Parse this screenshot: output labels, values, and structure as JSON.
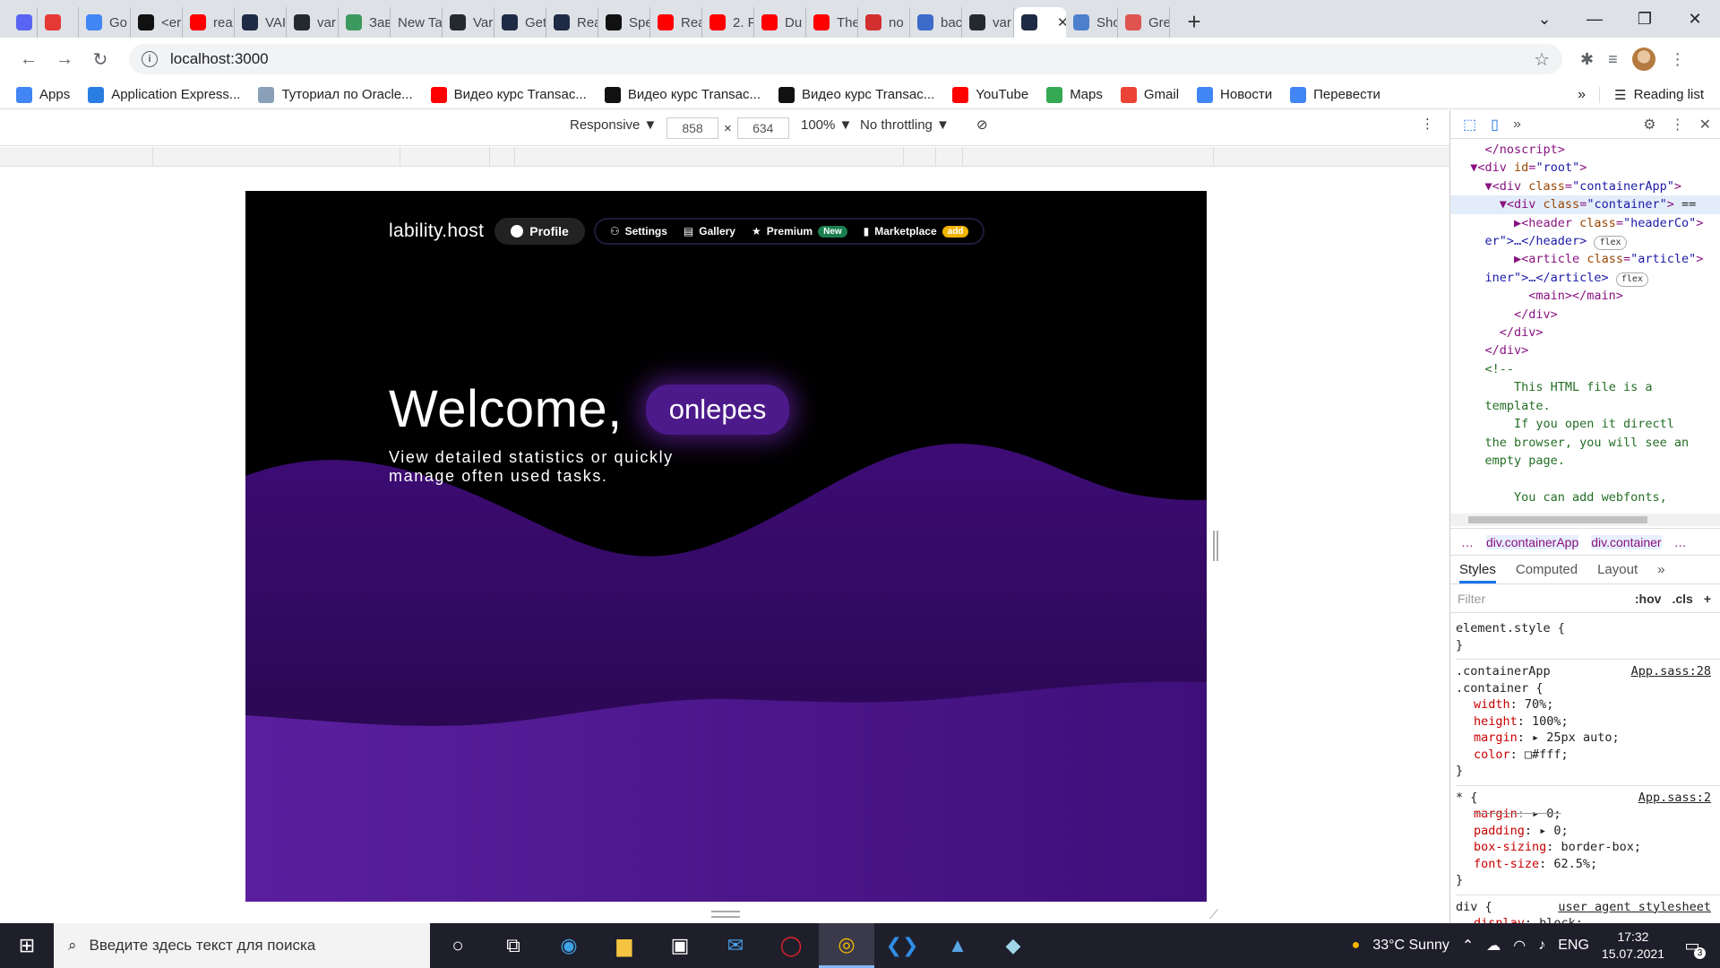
{
  "browser": {
    "tabs": [
      {
        "label": "",
        "color": "#5865f2"
      },
      {
        "label": "",
        "color": "#e53935"
      },
      {
        "label": "Go",
        "color": "#4285f4"
      },
      {
        "label": "<er",
        "color": "#111111"
      },
      {
        "label": "rea",
        "color": "#ff0000"
      },
      {
        "label": "VAI",
        "color": "#1f2a44"
      },
      {
        "label": "var",
        "color": "#24292e"
      },
      {
        "label": "Зав",
        "color": "#3c9a5f"
      },
      {
        "label": "New Tal",
        "color": ""
      },
      {
        "label": "Var",
        "color": "#24292e"
      },
      {
        "label": "Get",
        "color": "#1f2a44"
      },
      {
        "label": "Rea",
        "color": "#1f2a44"
      },
      {
        "label": "Spe",
        "color": "#111111"
      },
      {
        "label": "Rea",
        "color": "#ff0000"
      },
      {
        "label": "2. F",
        "color": "#ff0000"
      },
      {
        "label": "Du",
        "color": "#ff0000"
      },
      {
        "label": "The",
        "color": "#ff0000"
      },
      {
        "label": "no",
        "color": "#d32f2f"
      },
      {
        "label": "bac",
        "color": "#3c6bc9"
      },
      {
        "label": "var",
        "color": "#24292e"
      },
      {
        "label": "",
        "color": "#1f2a44",
        "active": true
      },
      {
        "label": "Sho",
        "color": "#4d7fcf"
      },
      {
        "label": "Gre",
        "color": "#e0544f"
      }
    ],
    "new_tab_glyph": "+",
    "url": "localhost:3000",
    "bookmarks": [
      {
        "label": "Apps",
        "icon": "apps-grid-icon",
        "color": "#4285f4"
      },
      {
        "label": "Application Express...",
        "icon": "apex-icon",
        "color": "#2a7de1"
      },
      {
        "label": "Туториал по Oracle...",
        "icon": "h-icon",
        "color": "#8aa0b8"
      },
      {
        "label": "Видео курс Transac...",
        "icon": "youtube-icon",
        "color": "#ff0000"
      },
      {
        "label": "Видео курс Transac...",
        "icon": "it-icon",
        "color": "#111111"
      },
      {
        "label": "Видео курс Transac...",
        "icon": "it-icon",
        "color": "#111111"
      },
      {
        "label": "YouTube",
        "icon": "youtube-icon",
        "color": "#ff0000"
      },
      {
        "label": "Maps",
        "icon": "maps-icon",
        "color": "#34a853"
      },
      {
        "label": "Gmail",
        "icon": "gmail-icon",
        "color": "#ea4335"
      },
      {
        "label": "Новости",
        "icon": "news-icon",
        "color": "#4285f4"
      },
      {
        "label": "Перевести",
        "icon": "translate-icon",
        "color": "#4285f4"
      }
    ],
    "bookmarks_more": "»",
    "reading_list": "Reading list"
  },
  "device_toolbar": {
    "mode": "Responsive ▼",
    "width": "858",
    "times": "×",
    "height": "634",
    "zoom": "100% ▼",
    "throttling": "No throttling ▼"
  },
  "app": {
    "logo": "lability.host",
    "profile_label": "Profile",
    "nav": [
      {
        "label": "Settings",
        "icon": "user-plus-icon"
      },
      {
        "label": "Gallery",
        "icon": "images-icon"
      },
      {
        "label": "Premium",
        "icon": "star-icon",
        "badge": "New",
        "badge_color": "#1a7f4e"
      },
      {
        "label": "Marketplace",
        "icon": "bag-icon",
        "badge": "add",
        "badge_color": "#f0b400"
      }
    ],
    "welcome": "Welcome,",
    "username": "onlepes",
    "subtitle": "View detailed statistics or quickly manage often used tasks.",
    "colors": {
      "wave_top": "#3a0a6e",
      "wave_mid": "#2a0650",
      "wave_bottom": "#5b1f9c"
    }
  },
  "devtools": {
    "elements": [
      {
        "indent": 2,
        "html": "</noscript>"
      },
      {
        "indent": 1,
        "arrow": "▼",
        "tag": "div",
        "attrs": [
          [
            "id",
            "root"
          ]
        ]
      },
      {
        "indent": 2,
        "arrow": "▼",
        "tag": "div",
        "attrs": [
          [
            "class",
            "containerApp"
          ]
        ]
      },
      {
        "indent": 3,
        "arrow": "▼",
        "tag": "div",
        "attrs": [
          [
            "class",
            "container"
          ]
        ],
        "highlight": true,
        "suffix": " =="
      },
      {
        "indent": 4,
        "arrow": "▶",
        "tag": "header",
        "attrs": [
          [
            "class",
            "headerCo"
          ]
        ],
        "wrap": "er\">…</header>",
        "badge": "flex"
      },
      {
        "indent": 4,
        "arrow": "▶",
        "tag": "article",
        "attrs": [
          [
            "class",
            "article"
          ]
        ],
        "wrap": "iner\">…</article>",
        "badge": "flex"
      },
      {
        "indent": 5,
        "raw": "<main></main>"
      },
      {
        "indent": 4,
        "raw": "</div>"
      },
      {
        "indent": 3,
        "raw": "</div>"
      },
      {
        "indent": 2,
        "raw": "</div>"
      },
      {
        "indent": 2,
        "comment": "<!--"
      },
      {
        "indent": 4,
        "text": "This HTML file is a"
      },
      {
        "indent": 2,
        "text": "template."
      },
      {
        "indent": 4,
        "text": "If you open it directl"
      },
      {
        "indent": 2,
        "text": "the browser, you will see an"
      },
      {
        "indent": 2,
        "text": "empty page."
      },
      {
        "indent": 2,
        "text": ""
      },
      {
        "indent": 4,
        "text": "You can add webfonts,"
      }
    ],
    "breadcrumbs": [
      "…",
      "div.containerApp",
      "div.container",
      "…"
    ],
    "subtabs": [
      "Styles",
      "Computed",
      "Layout",
      "»"
    ],
    "filter_placeholder": "Filter",
    "filter_tools": [
      ":hov",
      ".cls",
      "+"
    ],
    "rules": [
      {
        "selector": "element.style {",
        "src": "",
        "props": [],
        "close": "}"
      },
      {
        "selector": ".containerApp\n.container {",
        "src": "App.sass:28",
        "props": [
          {
            "name": "width",
            "value": "70%;"
          },
          {
            "name": "height",
            "value": "100%;"
          },
          {
            "name": "margin",
            "value": "▸ 25px auto;"
          },
          {
            "name": "color",
            "value": "□#fff;"
          }
        ],
        "close": "}"
      },
      {
        "selector": "* {",
        "src": "App.sass:2",
        "props": [
          {
            "name": "margin",
            "value": "▸ 0;",
            "struck": true
          },
          {
            "name": "padding",
            "value": "▸ 0;"
          },
          {
            "name": "box-sizing",
            "value": "border-box;"
          },
          {
            "name": "font-size",
            "value": "62.5%;"
          }
        ],
        "close": "}"
      },
      {
        "selector": "div {",
        "src": "user agent stylesheet",
        "props": [
          {
            "name": "display",
            "value": "block;"
          }
        ],
        "close": ""
      }
    ]
  },
  "taskbar": {
    "search_placeholder": "Введите здесь текст для поиска",
    "weather": "33°C  Sunny",
    "lang": "ENG",
    "time": "17:32",
    "date": "15.07.2021",
    "notifications": "3"
  }
}
